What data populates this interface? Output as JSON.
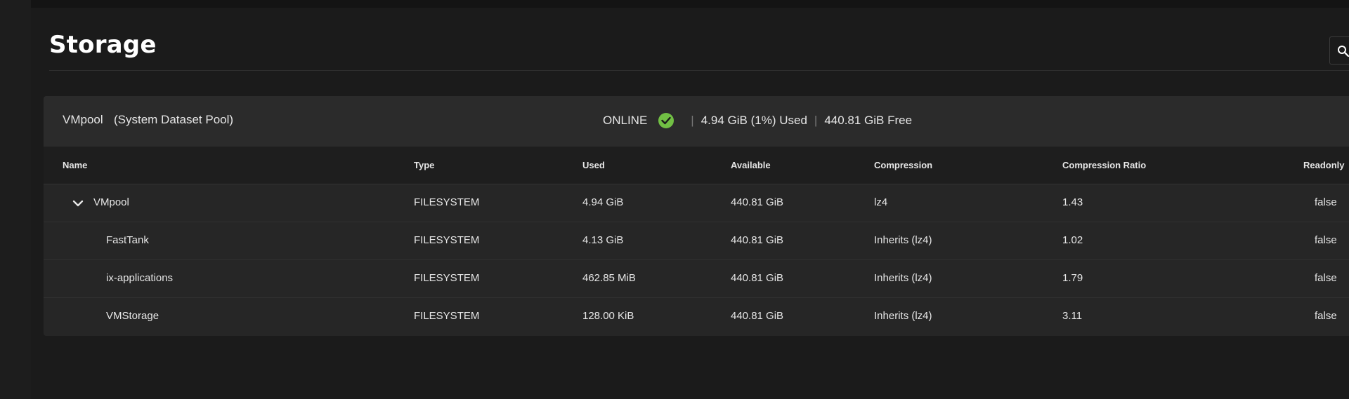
{
  "page": {
    "title": "Storage",
    "search_icon": "search-icon"
  },
  "pool": {
    "name": "VMpool",
    "subtitle": "(System Dataset Pool)",
    "status": "ONLINE",
    "status_icon": "check-circle-icon",
    "status_color": "#71bf44",
    "used": "4.94 GiB (1%) Used",
    "free": "440.81 GiB Free",
    "separator": "|"
  },
  "table": {
    "columns": [
      "Name",
      "Type",
      "Used",
      "Available",
      "Compression",
      "Compression Ratio",
      "Readonly"
    ],
    "rows": [
      {
        "name": "VMpool",
        "type": "FILESYSTEM",
        "used": "4.94 GiB",
        "available": "440.81 GiB",
        "compression": "lz4",
        "ratio": "1.43",
        "readonly": "false",
        "expanded": true
      },
      {
        "name": "FastTank",
        "type": "FILESYSTEM",
        "used": "4.13 GiB",
        "available": "440.81 GiB",
        "compression": "Inherits (lz4)",
        "ratio": "1.02",
        "readonly": "false"
      },
      {
        "name": "ix-applications",
        "type": "FILESYSTEM",
        "used": "462.85 MiB",
        "available": "440.81 GiB",
        "compression": "Inherits (lz4)",
        "ratio": "1.79",
        "readonly": "false"
      },
      {
        "name": "VMStorage",
        "type": "FILESYSTEM",
        "used": "128.00 KiB",
        "available": "440.81 GiB",
        "compression": "Inherits (lz4)",
        "ratio": "3.11",
        "readonly": "false"
      }
    ]
  }
}
